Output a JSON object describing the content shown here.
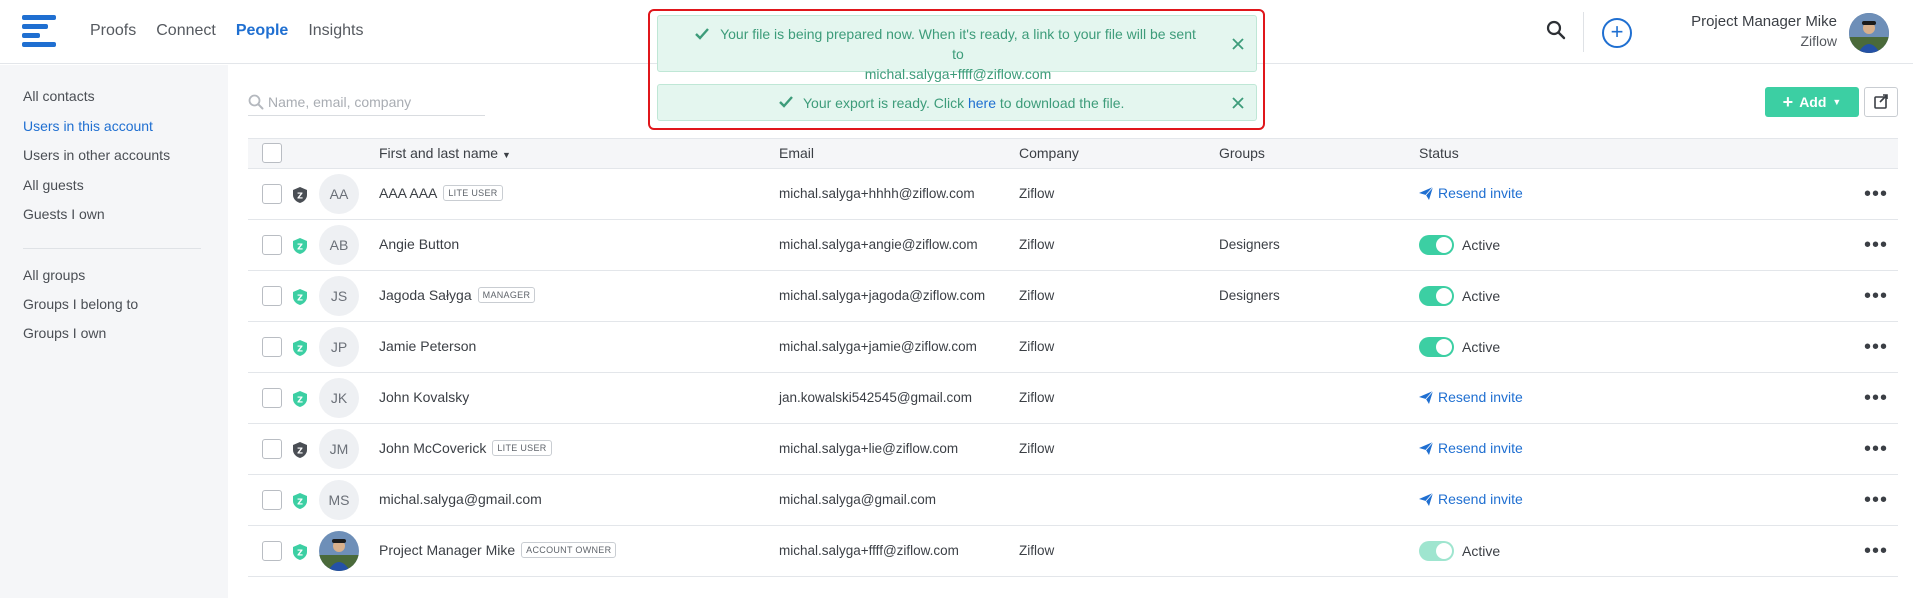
{
  "nav": {
    "items": [
      "Proofs",
      "Connect",
      "People",
      "Insights"
    ],
    "active": "People"
  },
  "user": {
    "name": "Project Manager Mike",
    "org": "Ziflow"
  },
  "sidebar": {
    "contacts": [
      "All contacts",
      "Users in this account",
      "Users in other accounts",
      "All guests",
      "Guests I own"
    ],
    "groups": [
      "All groups",
      "Groups I belong to",
      "Groups I own"
    ],
    "active": "Users in this account"
  },
  "search": {
    "placeholder": "Name, email, company",
    "value": ""
  },
  "toolbar": {
    "add_label": "Add"
  },
  "table": {
    "columns": [
      "First and last name",
      "Email",
      "Company",
      "Groups",
      "Status"
    ],
    "rows": [
      {
        "initials": "AA",
        "name": "AAA AAA",
        "badge": "LITE USER",
        "email": "michal.salyga+hhhh@ziflow.com",
        "company": "Ziflow",
        "groups": "",
        "status": "Resend invite",
        "shield": "dark"
      },
      {
        "initials": "AB",
        "name": "Angie Button",
        "badge": "",
        "email": "michal.salyga+angie@ziflow.com",
        "company": "Ziflow",
        "groups": "Designers",
        "status": "Active",
        "shield": "green"
      },
      {
        "initials": "JS",
        "name": "Jagoda Sałyga",
        "badge": "MANAGER",
        "email": "michal.salyga+jagoda@ziflow.com",
        "company": "Ziflow",
        "groups": "Designers",
        "status": "Active",
        "shield": "green"
      },
      {
        "initials": "JP",
        "name": "Jamie Peterson",
        "badge": "",
        "email": "michal.salyga+jamie@ziflow.com",
        "company": "Ziflow",
        "groups": "",
        "status": "Active",
        "shield": "green"
      },
      {
        "initials": "JK",
        "name": "John Kovalsky",
        "badge": "",
        "email": "jan.kowalski542545@gmail.com",
        "company": "Ziflow",
        "groups": "",
        "status": "Resend invite",
        "shield": "green"
      },
      {
        "initials": "JM",
        "name": "John McCoverick",
        "badge": "LITE USER",
        "email": "michal.salyga+lie@ziflow.com",
        "company": "Ziflow",
        "groups": "",
        "status": "Resend invite",
        "shield": "dark"
      },
      {
        "initials": "MS",
        "name": "michal.salyga@gmail.com",
        "badge": "",
        "email": "michal.salyga@gmail.com",
        "company": "",
        "groups": "",
        "status": "Resend invite",
        "shield": "green"
      },
      {
        "initials": "",
        "name": "Project Manager Mike",
        "badge": "ACCOUNT OWNER",
        "email": "michal.salyga+ffff@ziflow.com",
        "company": "Ziflow",
        "groups": "",
        "status": "Active",
        "shield": "green",
        "photo": true,
        "status_disabled": true
      }
    ]
  },
  "toasts": {
    "prepared": {
      "line1": "Your file is being prepared now. When it's ready, a link to your file will be sent to",
      "line2": "michal.salyga+ffff@ziflow.com"
    },
    "ready": {
      "before": "Your export is ready. Click ",
      "link": "here",
      "after": " to download the file."
    }
  },
  "colors": {
    "accent": "#1f6fd1",
    "success": "#3ccfa3",
    "toast_bg": "#e4f6ef",
    "highlight": "#e0161b"
  }
}
